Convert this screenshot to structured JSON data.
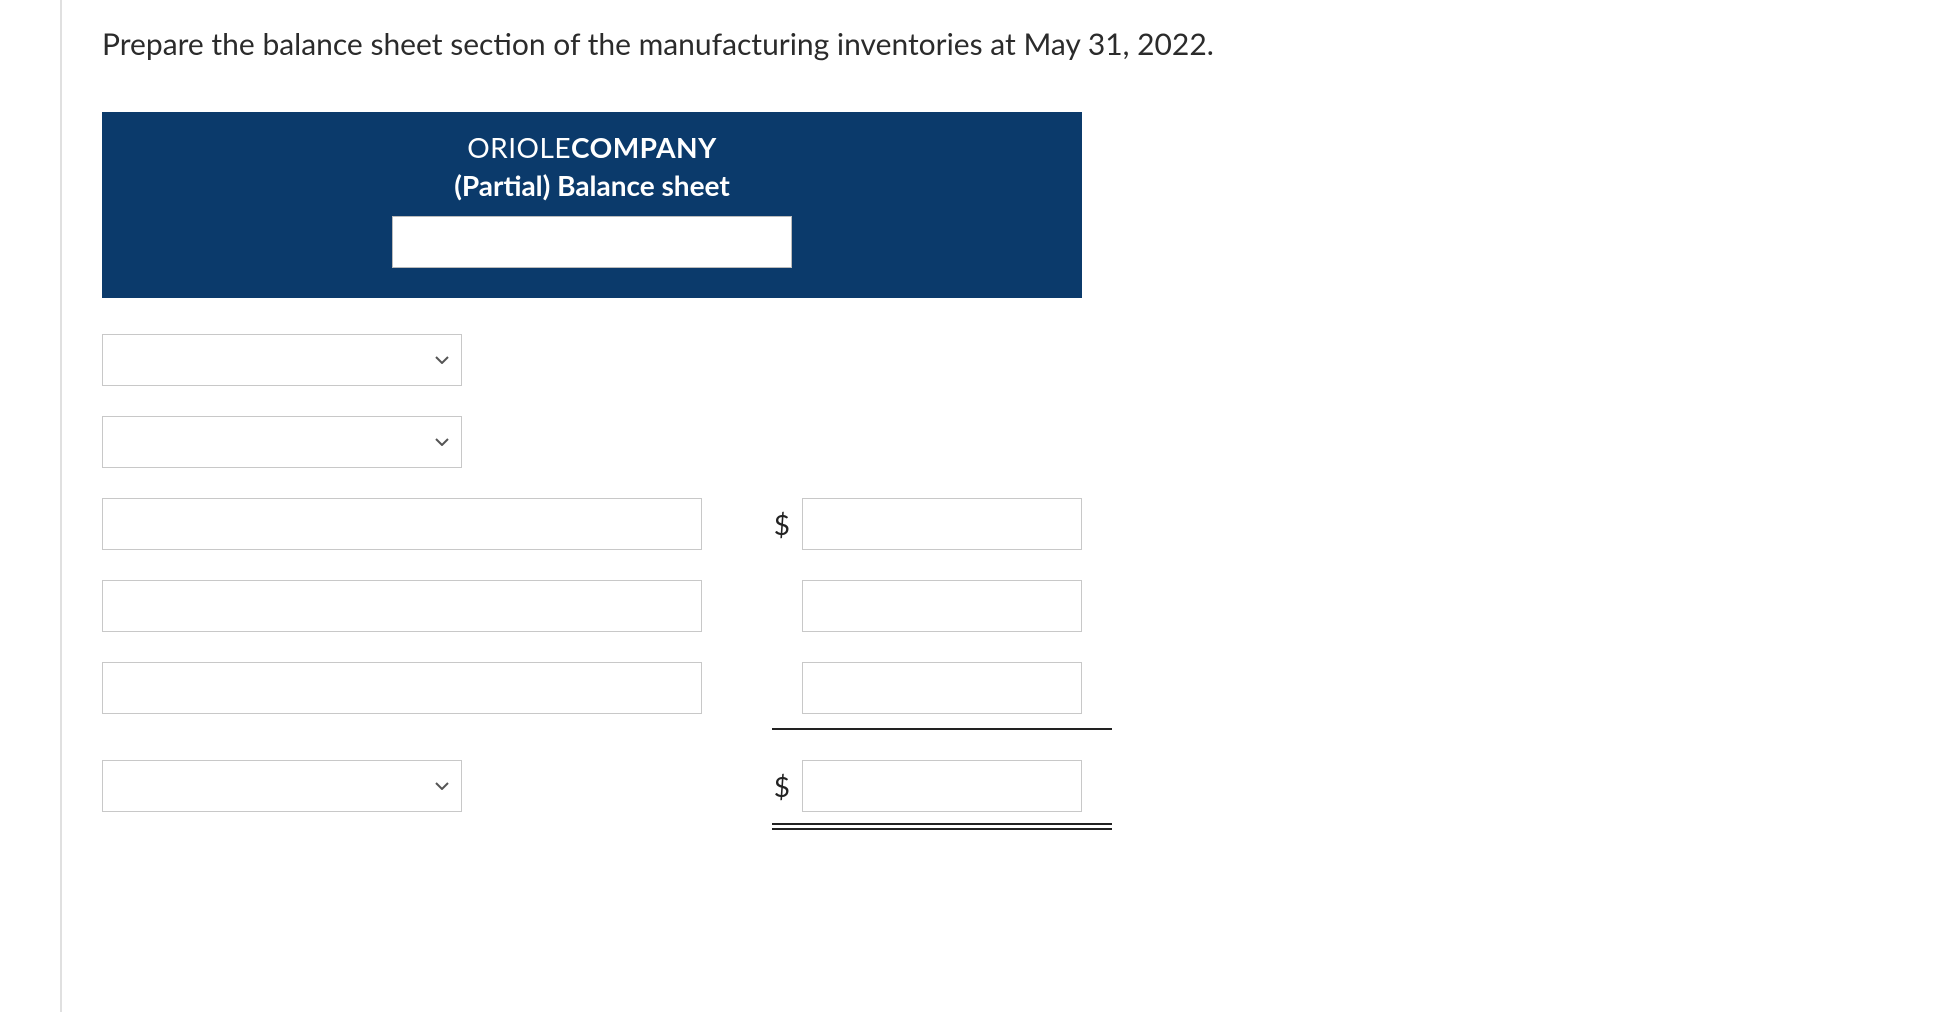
{
  "instruction_text": "Prepare the balance sheet section of the manufacturing inventories at May 31, 2022.",
  "header": {
    "company_prefix": "ORIOLE",
    "company_suffix": "COMPANY",
    "subtitle": "(Partial) Balance sheet",
    "date_select_value": ""
  },
  "rows": {
    "select1_value": "",
    "select2_value": "",
    "item1_label": "",
    "item1_amount": "",
    "item2_label": "",
    "item2_amount": "",
    "item3_label": "",
    "item3_amount": "",
    "total_select_value": "",
    "total_amount": ""
  },
  "symbols": {
    "dollar": "$"
  }
}
